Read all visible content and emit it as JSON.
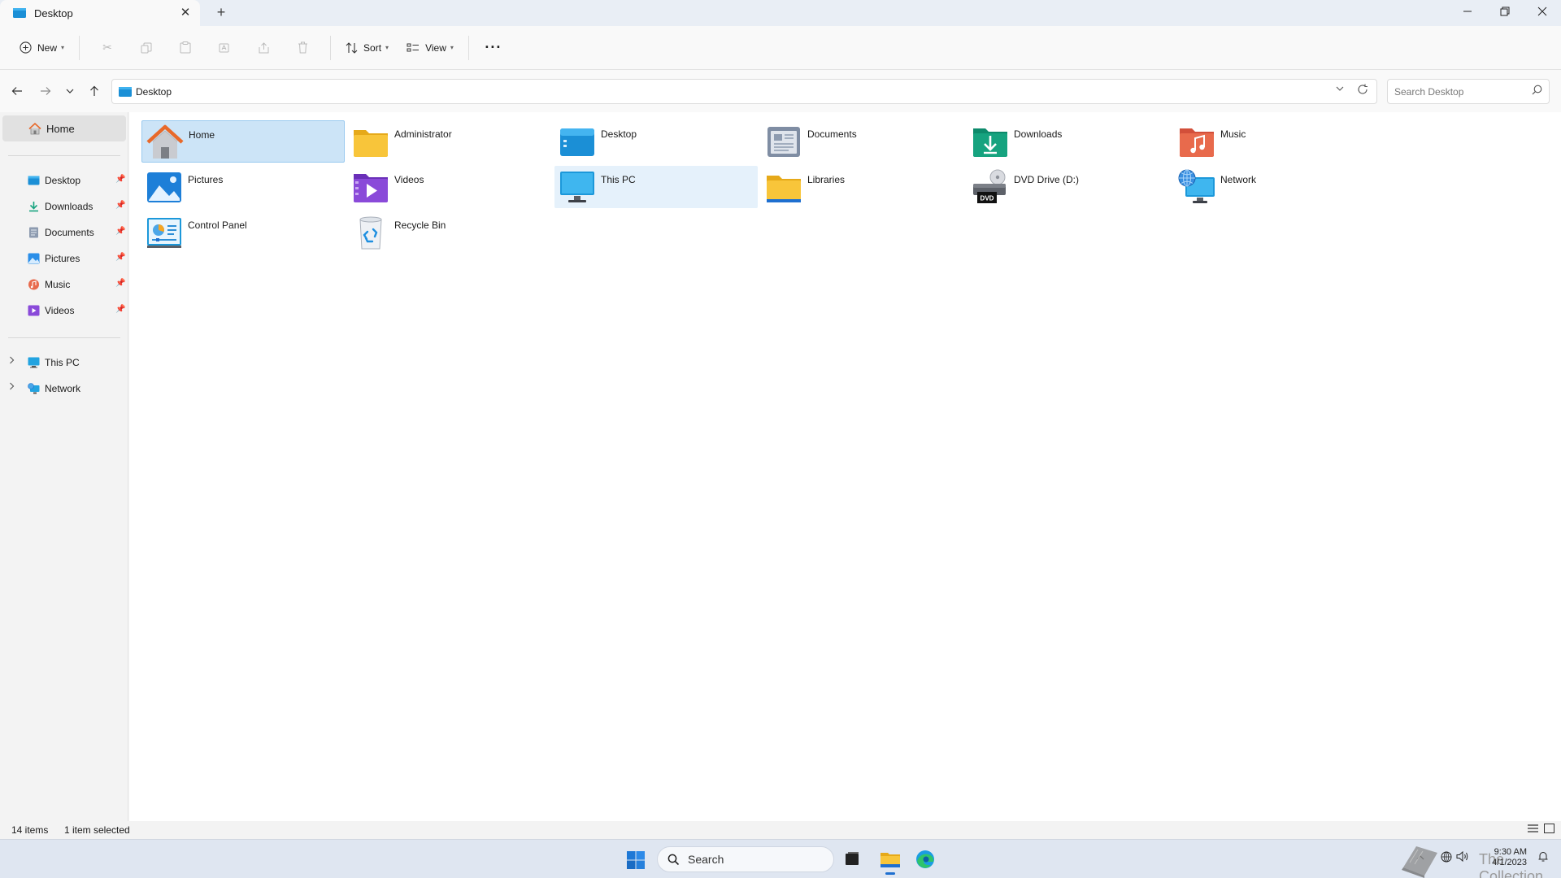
{
  "window": {
    "tab_title": "Desktop",
    "new_tab_symbol": "+",
    "close_tab_symbol": "✕"
  },
  "commandbar": {
    "new_label": "New",
    "sort_label": "Sort",
    "view_label": "View"
  },
  "address": {
    "crumb": "Desktop",
    "search_placeholder": "Search Desktop"
  },
  "nav": {
    "home": "Home",
    "quick_access": [
      {
        "label": "Desktop",
        "icon": "desktop-icon"
      },
      {
        "label": "Downloads",
        "icon": "downloads-icon"
      },
      {
        "label": "Documents",
        "icon": "documents-icon"
      },
      {
        "label": "Pictures",
        "icon": "pictures-icon"
      },
      {
        "label": "Music",
        "icon": "music-icon"
      },
      {
        "label": "Videos",
        "icon": "videos-icon"
      }
    ],
    "this_pc": "This PC",
    "network": "Network"
  },
  "items": [
    {
      "label": "Home",
      "icon": "home-icon",
      "state": "selected"
    },
    {
      "label": "Administrator",
      "icon": "folder-icon"
    },
    {
      "label": "Desktop",
      "icon": "desktop-folder-icon"
    },
    {
      "label": "Documents",
      "icon": "documents-folder-icon"
    },
    {
      "label": "Downloads",
      "icon": "downloads-folder-icon"
    },
    {
      "label": "Music",
      "icon": "music-folder-icon"
    },
    {
      "label": "Pictures",
      "icon": "pictures-folder-icon"
    },
    {
      "label": "Videos",
      "icon": "videos-folder-icon"
    },
    {
      "label": "This PC",
      "icon": "this-pc-icon",
      "state": "hover"
    },
    {
      "label": "Libraries",
      "icon": "libraries-icon"
    },
    {
      "label": "DVD Drive (D:)",
      "icon": "dvd-drive-icon",
      "badge": "DVD"
    },
    {
      "label": "Network",
      "icon": "network-icon"
    },
    {
      "label": "Control Panel",
      "icon": "control-panel-icon"
    },
    {
      "label": "Recycle Bin",
      "icon": "recycle-bin-icon"
    }
  ],
  "status": {
    "item_count": "14 items",
    "selection": "1 item selected"
  },
  "taskbar": {
    "search_label": "Search",
    "time": "9:30 AM",
    "date": "4/1/2023",
    "watermark": "The Collection Book"
  },
  "colors": {
    "selection": "#cce4f7",
    "accent": "#1e6fd0",
    "folder_yellow": "#f8c53a"
  }
}
